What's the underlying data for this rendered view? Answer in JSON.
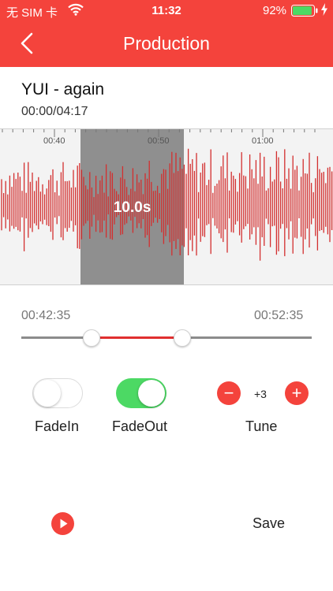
{
  "status_bar": {
    "carrier": "无 SIM 卡",
    "time": "11:32",
    "battery_percent": "92%",
    "battery_level": 0.92
  },
  "nav": {
    "title": "Production",
    "back_icon": "chevron-left-icon"
  },
  "track": {
    "title": "YUI - again",
    "position": "00:00/04:17"
  },
  "waveform": {
    "ticks": [
      "00:40",
      "00:50",
      "01:00"
    ],
    "selection_duration": "10.0s"
  },
  "range": {
    "start": "00:42:35",
    "end": "00:52:35"
  },
  "controls": {
    "fade_in": {
      "label": "FadeIn",
      "on": false
    },
    "fade_out": {
      "label": "FadeOut",
      "on": true
    },
    "tune": {
      "label": "Tune",
      "value": "+3",
      "minus": "−",
      "plus": "+"
    }
  },
  "footer": {
    "play_icon": "play-icon",
    "save_label": "Save"
  },
  "colors": {
    "accent": "#f4433c",
    "toggle_on": "#4cd964",
    "wave": "#d32f2f",
    "selection": "#8f8f8f"
  }
}
